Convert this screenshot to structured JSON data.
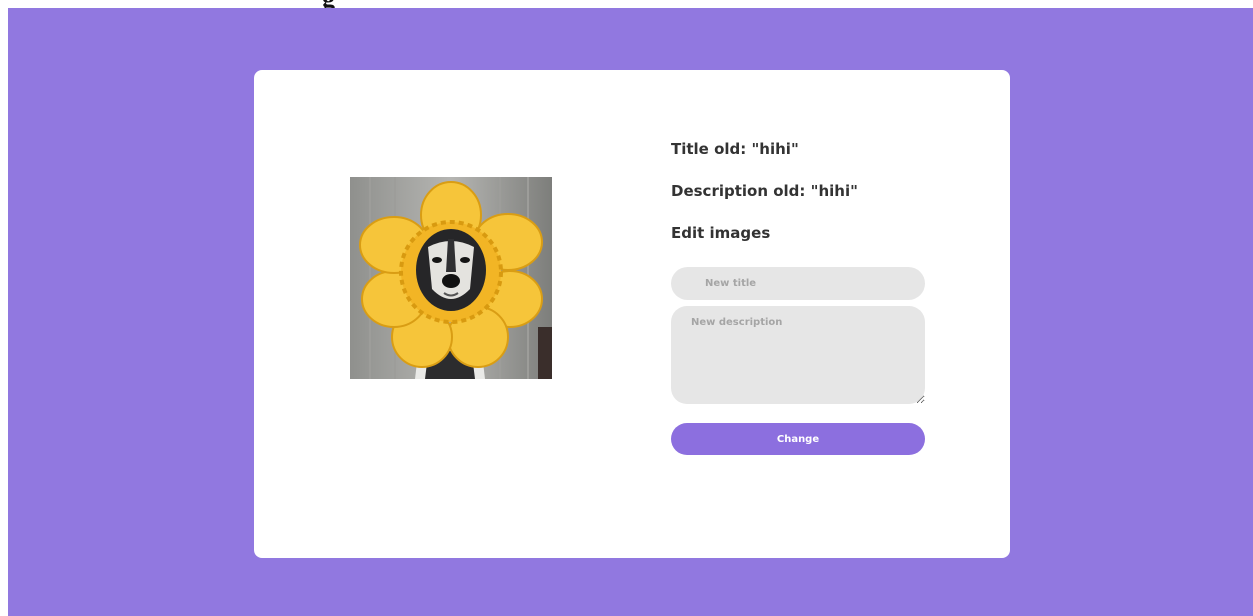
{
  "header": {
    "partial_text": "g"
  },
  "card": {
    "image_alt": "Husky wearing a yellow flower costume",
    "title_old": "Title old: \"hihi\"",
    "description_old": "Description old: \"hihi\"",
    "edit_heading": "Edit images",
    "title_input": {
      "placeholder": "New title",
      "value": ""
    },
    "description_input": {
      "placeholder": "New description",
      "value": ""
    },
    "change_button": "Change"
  },
  "colors": {
    "background": "#9178e0",
    "card": "#ffffff",
    "input": "#e6e6e6",
    "button": "#8c6fdf"
  }
}
